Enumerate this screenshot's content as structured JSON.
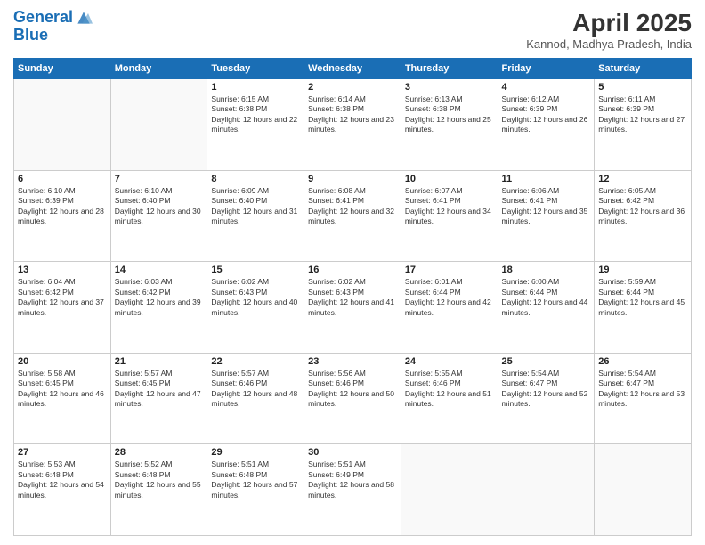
{
  "header": {
    "logo_line1": "General",
    "logo_line2": "Blue",
    "month": "April 2025",
    "location": "Kannod, Madhya Pradesh, India"
  },
  "days_of_week": [
    "Sunday",
    "Monday",
    "Tuesday",
    "Wednesday",
    "Thursday",
    "Friday",
    "Saturday"
  ],
  "weeks": [
    [
      {
        "day": "",
        "sunrise": "",
        "sunset": "",
        "daylight": ""
      },
      {
        "day": "",
        "sunrise": "",
        "sunset": "",
        "daylight": ""
      },
      {
        "day": "1",
        "sunrise": "Sunrise: 6:15 AM",
        "sunset": "Sunset: 6:38 PM",
        "daylight": "Daylight: 12 hours and 22 minutes."
      },
      {
        "day": "2",
        "sunrise": "Sunrise: 6:14 AM",
        "sunset": "Sunset: 6:38 PM",
        "daylight": "Daylight: 12 hours and 23 minutes."
      },
      {
        "day": "3",
        "sunrise": "Sunrise: 6:13 AM",
        "sunset": "Sunset: 6:38 PM",
        "daylight": "Daylight: 12 hours and 25 minutes."
      },
      {
        "day": "4",
        "sunrise": "Sunrise: 6:12 AM",
        "sunset": "Sunset: 6:39 PM",
        "daylight": "Daylight: 12 hours and 26 minutes."
      },
      {
        "day": "5",
        "sunrise": "Sunrise: 6:11 AM",
        "sunset": "Sunset: 6:39 PM",
        "daylight": "Daylight: 12 hours and 27 minutes."
      }
    ],
    [
      {
        "day": "6",
        "sunrise": "Sunrise: 6:10 AM",
        "sunset": "Sunset: 6:39 PM",
        "daylight": "Daylight: 12 hours and 28 minutes."
      },
      {
        "day": "7",
        "sunrise": "Sunrise: 6:10 AM",
        "sunset": "Sunset: 6:40 PM",
        "daylight": "Daylight: 12 hours and 30 minutes."
      },
      {
        "day": "8",
        "sunrise": "Sunrise: 6:09 AM",
        "sunset": "Sunset: 6:40 PM",
        "daylight": "Daylight: 12 hours and 31 minutes."
      },
      {
        "day": "9",
        "sunrise": "Sunrise: 6:08 AM",
        "sunset": "Sunset: 6:41 PM",
        "daylight": "Daylight: 12 hours and 32 minutes."
      },
      {
        "day": "10",
        "sunrise": "Sunrise: 6:07 AM",
        "sunset": "Sunset: 6:41 PM",
        "daylight": "Daylight: 12 hours and 34 minutes."
      },
      {
        "day": "11",
        "sunrise": "Sunrise: 6:06 AM",
        "sunset": "Sunset: 6:41 PM",
        "daylight": "Daylight: 12 hours and 35 minutes."
      },
      {
        "day": "12",
        "sunrise": "Sunrise: 6:05 AM",
        "sunset": "Sunset: 6:42 PM",
        "daylight": "Daylight: 12 hours and 36 minutes."
      }
    ],
    [
      {
        "day": "13",
        "sunrise": "Sunrise: 6:04 AM",
        "sunset": "Sunset: 6:42 PM",
        "daylight": "Daylight: 12 hours and 37 minutes."
      },
      {
        "day": "14",
        "sunrise": "Sunrise: 6:03 AM",
        "sunset": "Sunset: 6:42 PM",
        "daylight": "Daylight: 12 hours and 39 minutes."
      },
      {
        "day": "15",
        "sunrise": "Sunrise: 6:02 AM",
        "sunset": "Sunset: 6:43 PM",
        "daylight": "Daylight: 12 hours and 40 minutes."
      },
      {
        "day": "16",
        "sunrise": "Sunrise: 6:02 AM",
        "sunset": "Sunset: 6:43 PM",
        "daylight": "Daylight: 12 hours and 41 minutes."
      },
      {
        "day": "17",
        "sunrise": "Sunrise: 6:01 AM",
        "sunset": "Sunset: 6:44 PM",
        "daylight": "Daylight: 12 hours and 42 minutes."
      },
      {
        "day": "18",
        "sunrise": "Sunrise: 6:00 AM",
        "sunset": "Sunset: 6:44 PM",
        "daylight": "Daylight: 12 hours and 44 minutes."
      },
      {
        "day": "19",
        "sunrise": "Sunrise: 5:59 AM",
        "sunset": "Sunset: 6:44 PM",
        "daylight": "Daylight: 12 hours and 45 minutes."
      }
    ],
    [
      {
        "day": "20",
        "sunrise": "Sunrise: 5:58 AM",
        "sunset": "Sunset: 6:45 PM",
        "daylight": "Daylight: 12 hours and 46 minutes."
      },
      {
        "day": "21",
        "sunrise": "Sunrise: 5:57 AM",
        "sunset": "Sunset: 6:45 PM",
        "daylight": "Daylight: 12 hours and 47 minutes."
      },
      {
        "day": "22",
        "sunrise": "Sunrise: 5:57 AM",
        "sunset": "Sunset: 6:46 PM",
        "daylight": "Daylight: 12 hours and 48 minutes."
      },
      {
        "day": "23",
        "sunrise": "Sunrise: 5:56 AM",
        "sunset": "Sunset: 6:46 PM",
        "daylight": "Daylight: 12 hours and 50 minutes."
      },
      {
        "day": "24",
        "sunrise": "Sunrise: 5:55 AM",
        "sunset": "Sunset: 6:46 PM",
        "daylight": "Daylight: 12 hours and 51 minutes."
      },
      {
        "day": "25",
        "sunrise": "Sunrise: 5:54 AM",
        "sunset": "Sunset: 6:47 PM",
        "daylight": "Daylight: 12 hours and 52 minutes."
      },
      {
        "day": "26",
        "sunrise": "Sunrise: 5:54 AM",
        "sunset": "Sunset: 6:47 PM",
        "daylight": "Daylight: 12 hours and 53 minutes."
      }
    ],
    [
      {
        "day": "27",
        "sunrise": "Sunrise: 5:53 AM",
        "sunset": "Sunset: 6:48 PM",
        "daylight": "Daylight: 12 hours and 54 minutes."
      },
      {
        "day": "28",
        "sunrise": "Sunrise: 5:52 AM",
        "sunset": "Sunset: 6:48 PM",
        "daylight": "Daylight: 12 hours and 55 minutes."
      },
      {
        "day": "29",
        "sunrise": "Sunrise: 5:51 AM",
        "sunset": "Sunset: 6:48 PM",
        "daylight": "Daylight: 12 hours and 57 minutes."
      },
      {
        "day": "30",
        "sunrise": "Sunrise: 5:51 AM",
        "sunset": "Sunset: 6:49 PM",
        "daylight": "Daylight: 12 hours and 58 minutes."
      },
      {
        "day": "",
        "sunrise": "",
        "sunset": "",
        "daylight": ""
      },
      {
        "day": "",
        "sunrise": "",
        "sunset": "",
        "daylight": ""
      },
      {
        "day": "",
        "sunrise": "",
        "sunset": "",
        "daylight": ""
      }
    ]
  ]
}
